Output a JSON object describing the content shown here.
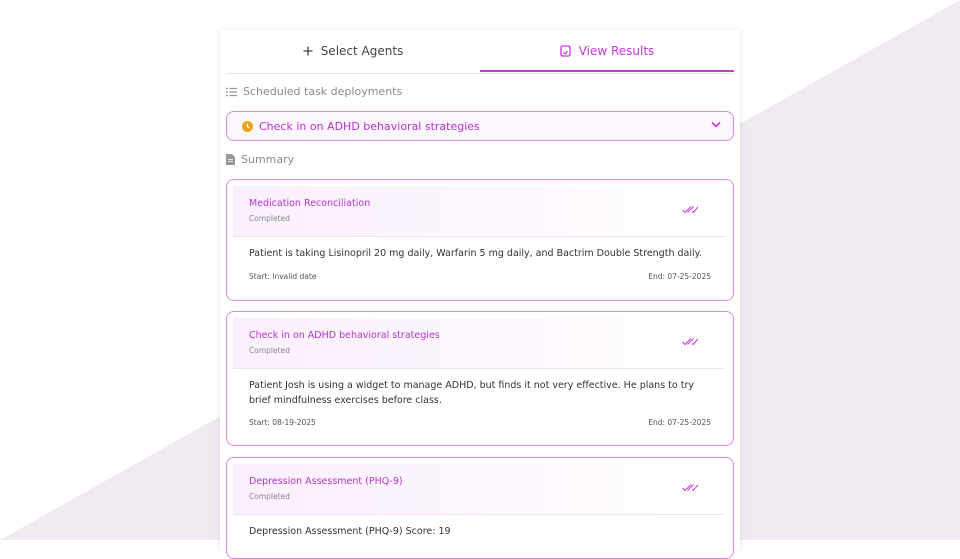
{
  "tabs": [
    {
      "label": "Select Agents",
      "icon": "plus-icon",
      "active": false
    },
    {
      "label": "View Results",
      "icon": "results-icon",
      "active": true
    }
  ],
  "scheduled": {
    "heading": "Scheduled task deployments",
    "selected": "Check in on ADHD behavioral strategies"
  },
  "summary": {
    "heading": "Summary",
    "cards": [
      {
        "title": "Medication Reconciliation",
        "status": "Completed",
        "body": "Patient is taking Lisinopril 20 mg daily, Warfarin 5 mg daily, and Bactrim Double Strength daily.",
        "start": "Start: Invalid date",
        "end": "End: 07-25-2025"
      },
      {
        "title": "Check in on ADHD behavioral strategies",
        "status": "Completed",
        "body": "Patient Josh is using a widget to manage ADHD, but finds it not very effective. He plans to try brief mindfulness exercises before class.",
        "start": "Start: 08-19-2025",
        "end": "End: 07-25-2025"
      },
      {
        "title": "Depression Assessment (PHQ-9)",
        "status": "Completed",
        "body": "Depression Assessment (PHQ-9) Score: 19",
        "start": "",
        "end": ""
      }
    ]
  },
  "colors": {
    "accent": "#c23ad6",
    "warning": "#e8a317",
    "border": "#d88be6"
  }
}
